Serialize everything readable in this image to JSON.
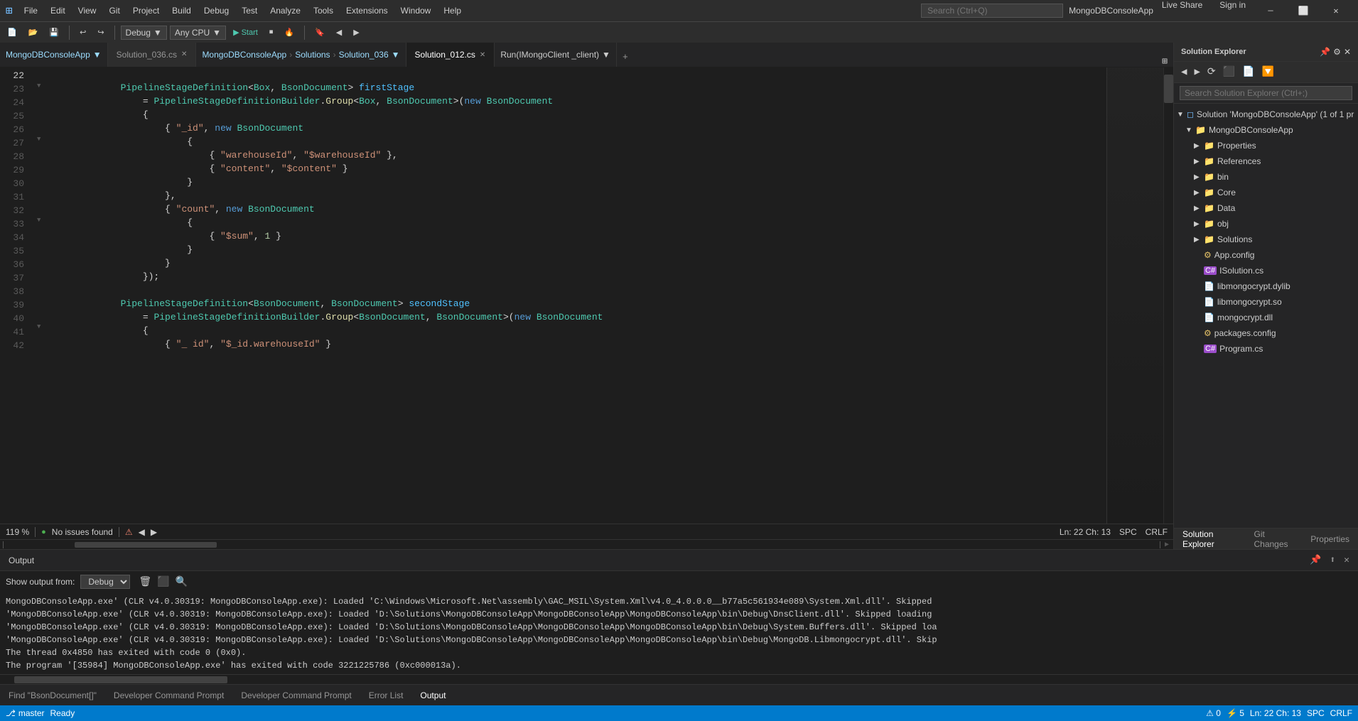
{
  "titleBar": {
    "logo": "⊞",
    "menus": [
      "File",
      "Edit",
      "View",
      "Git",
      "Project",
      "Build",
      "Debug",
      "Test",
      "Analyze",
      "Tools",
      "Extensions",
      "Window",
      "Help"
    ],
    "search": "Search (Ctrl+Q)",
    "appName": "MongoDBConsoleApp",
    "signIn": "Sign in",
    "liveShare": "Live Share",
    "windowButtons": [
      "—",
      "⬜",
      "✕"
    ]
  },
  "toolbar": {
    "debugMode": "Debug",
    "cpu": "Any CPU",
    "startLabel": "▶ Start",
    "buttons": [
      "↩",
      "↪",
      "⟳"
    ]
  },
  "tabs": {
    "left": [
      {
        "label": "Solution_036.cs",
        "active": false,
        "modified": false
      },
      {
        "label": "Solution_012.cs",
        "active": true,
        "modified": false
      }
    ],
    "breadcrumb": [
      "MongoDBConsoleApp",
      "Solutions",
      "Solution_036"
    ]
  },
  "editorHeader": {
    "method": "Run(IMongoClient _client)"
  },
  "code": {
    "lines": [
      {
        "num": 22,
        "content": ""
      },
      {
        "num": 23,
        "content": "            PipelineStageDefinition<Box, BsonDocument> firstStage"
      },
      {
        "num": 24,
        "content": "                = PipelineStageDefinitionBuilder.Group<Box, BsonDocument>(new BsonDocument"
      },
      {
        "num": 25,
        "content": "                {"
      },
      {
        "num": 26,
        "content": "                    { \"_id\", new BsonDocument"
      },
      {
        "num": 27,
        "content": "                        {"
      },
      {
        "num": 28,
        "content": "                            { \"warehouseId\", \"$warehouseId\" },"
      },
      {
        "num": 29,
        "content": "                            { \"content\", \"$content\" }"
      },
      {
        "num": 30,
        "content": "                        }"
      },
      {
        "num": 31,
        "content": "                    },"
      },
      {
        "num": 32,
        "content": "                    { \"count\", new BsonDocument"
      },
      {
        "num": 33,
        "content": "                        {"
      },
      {
        "num": 34,
        "content": "                            { \"$sum\", 1 }"
      },
      {
        "num": 35,
        "content": "                        }"
      },
      {
        "num": 36,
        "content": "                    }"
      },
      {
        "num": 37,
        "content": "                });"
      },
      {
        "num": 38,
        "content": ""
      },
      {
        "num": 39,
        "content": "            PipelineStageDefinition<BsonDocument, BsonDocument> secondStage"
      },
      {
        "num": 40,
        "content": "                = PipelineStageDefinitionBuilder.Group<BsonDocument, BsonDocument>(new BsonDocument"
      },
      {
        "num": 41,
        "content": "                {"
      },
      {
        "num": 42,
        "content": "                    { \"_ id\", \"$_id.warehouseId\" }"
      }
    ]
  },
  "statusBar": {
    "errors": "0 / 0",
    "warnings": "5",
    "lineCol": "Ln: 22  Ch: 13",
    "encoding": "SPC",
    "lineEnding": "CRLF",
    "zoom": "119 %",
    "issues": "No issues found"
  },
  "output": {
    "title": "Output",
    "showOutputFrom": "Show output from:",
    "source": "Debug",
    "lines": [
      "MongoDBConsoleApp.exe' (CLR v4.0.30319: MongoDBConsoleApp.exe): Loaded 'C:\\Windows\\Microsoft.Net\\assembly\\GAC_MSIL\\System.Xml\\v4.0_4.0.0.0__b77a5c561934e089\\System.Xml.dll'. Skipped",
      "'MongoDBConsoleApp.exe' (CLR v4.0.30319: MongoDBConsoleApp.exe): Loaded 'D:\\Solutions\\MongoDBConsoleApp\\MongoDBConsoleApp\\MongoDBConsoleApp\\bin\\Debug\\DnsClient.dll'. Skipped loading",
      "'MongoDBConsoleApp.exe' (CLR v4.0.30319: MongoDBConsoleApp.exe): Loaded 'D:\\Solutions\\MongoDBConsoleApp\\MongoDBConsoleApp\\MongoDBConsoleApp\\bin\\Debug\\System.Buffers.dll'. Skipped loa",
      "'MongoDBConsoleApp.exe' (CLR v4.0.30319: MongoDBConsoleApp.exe): Loaded 'D:\\Solutions\\MongoDBConsoleApp\\MongoDBConsoleApp\\MongoDBConsoleApp\\bin\\Debug\\MongoDB.Libmongocrypt.dll'. Skip",
      "The thread 0x4850 has exited with code 0 (0x0).",
      "The program '[35984] MongoDBConsoleApp.exe' has exited with code 3221225786 (0xc000013a)."
    ]
  },
  "bottomTabs": [
    {
      "label": "Find \"BsonDocument[]\"",
      "active": false
    },
    {
      "label": "Developer Command Prompt",
      "active": false
    },
    {
      "label": "Developer Command Prompt",
      "active": false
    },
    {
      "label": "Error List",
      "active": false
    },
    {
      "label": "Output",
      "active": true
    }
  ],
  "solutionExplorer": {
    "title": "Solution Explorer",
    "search": {
      "placeholder": "Search Solution Explorer (Ctrl+;)"
    },
    "tree": [
      {
        "indent": 0,
        "type": "solution",
        "icon": "📁",
        "label": "Solution 'MongoDBConsoleApp' (1 of 1 pr",
        "expanded": true
      },
      {
        "indent": 1,
        "type": "project",
        "icon": "📁",
        "label": "MongoDBConsoleApp",
        "expanded": true
      },
      {
        "indent": 2,
        "type": "folder",
        "icon": "📁",
        "label": "Properties",
        "expanded": false
      },
      {
        "indent": 2,
        "type": "folder",
        "icon": "📁",
        "label": "References",
        "expanded": false
      },
      {
        "indent": 2,
        "type": "folder",
        "icon": "📁",
        "label": "bin",
        "expanded": false
      },
      {
        "indent": 2,
        "type": "folder",
        "icon": "📁",
        "label": "Core",
        "expanded": false
      },
      {
        "indent": 2,
        "type": "folder",
        "icon": "📁",
        "label": "Data",
        "expanded": false
      },
      {
        "indent": 2,
        "type": "folder",
        "icon": "📁",
        "label": "obj",
        "expanded": false
      },
      {
        "indent": 2,
        "type": "folder",
        "icon": "📁",
        "label": "Solutions",
        "expanded": false
      },
      {
        "indent": 2,
        "type": "config",
        "icon": "⚙",
        "label": "App.config"
      },
      {
        "indent": 2,
        "type": "csharp",
        "icon": "C#",
        "label": "ISolution.cs"
      },
      {
        "indent": 2,
        "type": "file",
        "icon": "📄",
        "label": "libmongocrypt.dylib"
      },
      {
        "indent": 2,
        "type": "file",
        "icon": "📄",
        "label": "libmongocrypt.so"
      },
      {
        "indent": 2,
        "type": "file",
        "icon": "📄",
        "label": "mongocrypt.dll"
      },
      {
        "indent": 2,
        "type": "config",
        "icon": "⚙",
        "label": "packages.config"
      },
      {
        "indent": 2,
        "type": "csharp",
        "icon": "C#",
        "label": "Program.cs"
      }
    ],
    "tabs": [
      "Solution Explorer",
      "Git Changes",
      "Properties"
    ]
  },
  "mainStatusBar": {
    "ready": "Ready",
    "branch": "master",
    "gitIcon": "⎇"
  }
}
